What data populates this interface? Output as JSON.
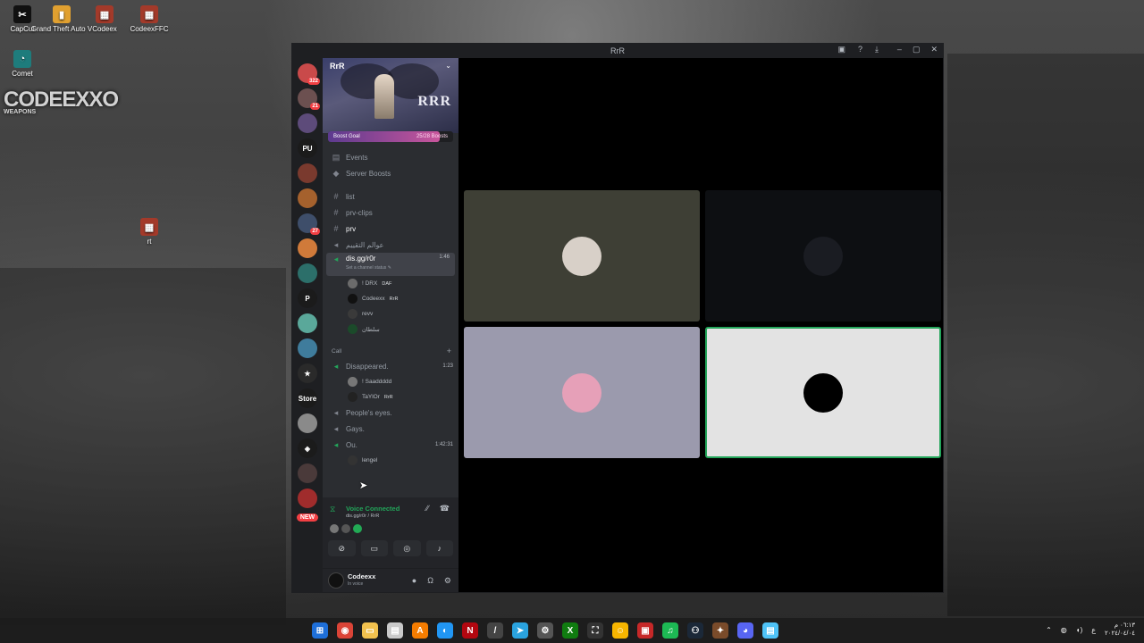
{
  "desktop": {
    "icons": [
      {
        "label": "CapCut",
        "name": "capcut-desktop-icon",
        "glyph": "✂",
        "bg": "#111111"
      },
      {
        "label": "Grand Theft Auto V",
        "name": "gta-desktop-icon",
        "glyph": "▮",
        "bg": "#e0a030"
      },
      {
        "label": "Codeex",
        "name": "codeex-desktop-icon",
        "glyph": "▦",
        "bg": "#a33a2a"
      },
      {
        "label": "CodeexFFC",
        "name": "codeexffc-desktop-icon",
        "glyph": "▦",
        "bg": "#a33a2a"
      },
      {
        "label": "Comet",
        "name": "comet-desktop-icon",
        "glyph": "◔",
        "bg": "#1e7c7c"
      },
      {
        "label": "rt",
        "name": "rt-desktop-icon",
        "glyph": "▦",
        "bg": "#a33a2a"
      }
    ],
    "watermark": "CODEEXXO",
    "watermark_sub": "WEAPONS"
  },
  "window": {
    "title": "RrR"
  },
  "servers": [
    {
      "name": "server-dm-home",
      "label": "",
      "badge": "322",
      "bg": "#c94a4a"
    },
    {
      "name": "server-avatar-1",
      "label": "",
      "badge": "21",
      "bg": "#6c5050"
    },
    {
      "name": "server-avatar-2",
      "label": "",
      "badge": "",
      "bg": "#5d4b7a"
    },
    {
      "name": "server-pu",
      "label": "PU",
      "badge": "",
      "bg": "#1b1b1b"
    },
    {
      "name": "server-avatar-3",
      "label": "",
      "badge": "",
      "bg": "#7a3a2e"
    },
    {
      "name": "server-avatar-4",
      "label": "",
      "badge": "",
      "bg": "#a5612d"
    },
    {
      "name": "server-avatar-5",
      "label": "",
      "badge": "27",
      "bg": "#3e4e6a"
    },
    {
      "name": "server-avatar-6",
      "label": "",
      "badge": "",
      "bg": "#d07a3a"
    },
    {
      "name": "server-avatar-7",
      "label": "",
      "badge": "",
      "bg": "#2c6f6a"
    },
    {
      "name": "server-p",
      "label": "P",
      "badge": "",
      "bg": "#1b1b1b"
    },
    {
      "name": "server-avatar-8",
      "label": "",
      "badge": "",
      "bg": "#5aa89a"
    },
    {
      "name": "server-avatar-9",
      "label": "",
      "badge": "",
      "bg": "#3f7c9c"
    },
    {
      "name": "server-avatar-10",
      "label": "★",
      "badge": "",
      "bg": "#2a2a2a"
    },
    {
      "name": "server-store",
      "label": "Store",
      "badge": "",
      "bg": "#1b1b1b"
    },
    {
      "name": "server-avatar-11",
      "label": "",
      "badge": "",
      "bg": "#8a8a8a"
    },
    {
      "name": "server-avatar-12",
      "label": "◈",
      "badge": "",
      "bg": "#1b1b1b"
    },
    {
      "name": "server-avatar-13",
      "label": "",
      "badge": "",
      "bg": "#4a3a3a"
    },
    {
      "name": "server-avatar-14",
      "label": "",
      "badge": "",
      "bg": "#a02c2c"
    }
  ],
  "new_badge": "NEW",
  "sidebar": {
    "server_name": "RrR",
    "banner_logo": "RRR",
    "boost_goal": "Boost Goal",
    "boost_count": "25/28 Boosts",
    "boost_progress": 0.89,
    "events": "Events",
    "server_boosts": "Server Boosts",
    "ch_list": "list",
    "ch_prv_clips": "prv-clips",
    "ch_prv": "prv",
    "ch_arabic": "عوالم التقييم",
    "active_vc": "dis.gg/r0r",
    "active_vc_time": "1:46",
    "active_vc_status": "Set a channel status ✎",
    "vc_members": [
      {
        "name": "! DRX",
        "tag": "DAF",
        "avatar": "#6b6b6b"
      },
      {
        "name": "Codeexx",
        "tag": "RrR",
        "avatar": "#111111"
      },
      {
        "name": "revv",
        "tag": "",
        "avatar": "#3a3a3a"
      },
      {
        "name": "سلطان",
        "tag": "",
        "avatar": "#1b4a2a"
      }
    ],
    "category_call": "Call",
    "vc_disappeared": "Disappeared.",
    "vc_disappeared_time": "1:23",
    "disappeared_members": [
      {
        "name": "! Saaddddd",
        "tag": "",
        "avatar": "#777777"
      },
      {
        "name": "TaYlOr",
        "tag": "RrR",
        "avatar": "#222222"
      }
    ],
    "vc_peoples_eyes": "People's eyes.",
    "vc_gays": "Gays.",
    "vc_ou": "Ou.",
    "vc_ou_time": "1:42:31",
    "ou_members": [
      {
        "name": "lengel",
        "tag": "",
        "avatar": "#333333"
      }
    ]
  },
  "voice": {
    "status": "Voice Connected",
    "channel": "dis.gg/r0r / RrR"
  },
  "user": {
    "name": "Codeexx",
    "status": "In voice"
  },
  "stage": {
    "tiles": [
      {
        "name": "video-tile-1",
        "bg": "#3e3f35",
        "avatar": "#d8d0c8"
      },
      {
        "name": "video-tile-2",
        "bg": "#0d0f12",
        "avatar": "#1a1c22"
      },
      {
        "name": "video-tile-3",
        "bg": "#9b9aad",
        "avatar": "#e6a0b8"
      },
      {
        "name": "video-tile-4",
        "bg": "#e3e3e3",
        "avatar": "#000000"
      }
    ]
  },
  "taskbar": {
    "apps": [
      {
        "name": "windows-start-icon",
        "glyph": "⊞",
        "bg": "#1e6fd9"
      },
      {
        "name": "chrome-icon",
        "glyph": "◉",
        "bg": "#db4437"
      },
      {
        "name": "file-explorer-icon",
        "glyph": "▭",
        "bg": "#f2c14e"
      },
      {
        "name": "archive-app-icon",
        "glyph": "▤",
        "bg": "#c9c9c9"
      },
      {
        "name": "app-a-icon",
        "glyph": "A",
        "bg": "#f57c00"
      },
      {
        "name": "app-blue-icon",
        "glyph": "◐",
        "bg": "#2196f3"
      },
      {
        "name": "netflix-icon",
        "glyph": "N",
        "bg": "#b20710"
      },
      {
        "name": "app-slash-icon",
        "glyph": "/",
        "bg": "#444444"
      },
      {
        "name": "telegram-icon",
        "glyph": "➤",
        "bg": "#2aa3df"
      },
      {
        "name": "settings-icon",
        "glyph": "⚙",
        "bg": "#555555"
      },
      {
        "name": "xbox-icon",
        "glyph": "X",
        "bg": "#107c10"
      },
      {
        "name": "capture-icon",
        "glyph": "⛶",
        "bg": "#333333"
      },
      {
        "name": "app-smile-icon",
        "glyph": "☺",
        "bg": "#f7b500"
      },
      {
        "name": "app-red-icon",
        "glyph": "▣",
        "bg": "#c62828"
      },
      {
        "name": "spotify-icon",
        "glyph": "♫",
        "bg": "#1db954"
      },
      {
        "name": "steam-icon",
        "glyph": "⚇",
        "bg": "#1b2838"
      },
      {
        "name": "app-game-icon",
        "glyph": "✦",
        "bg": "#7a4b2a"
      },
      {
        "name": "discord-icon",
        "glyph": "◕",
        "bg": "#5865f2"
      },
      {
        "name": "notepad-icon",
        "glyph": "▤",
        "bg": "#4fc3f7"
      }
    ],
    "tray_lang": "ع",
    "clock_time": "٠٦:١٣ م",
    "clock_date": "٢٠٢٤/٠٤/٠٤"
  }
}
